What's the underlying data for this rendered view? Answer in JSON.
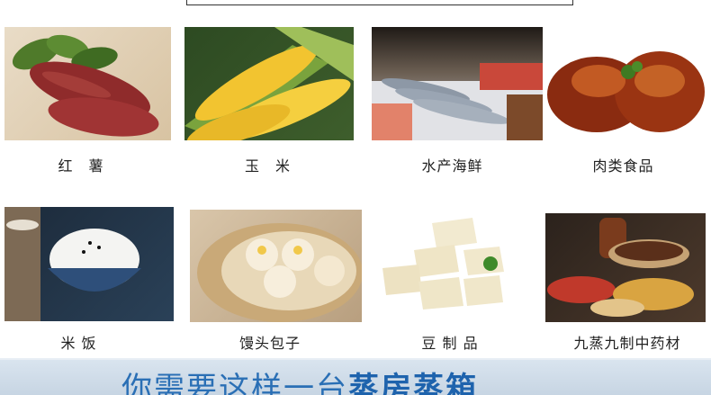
{
  "items": [
    {
      "label": "红　薯"
    },
    {
      "label": "玉　米"
    },
    {
      "label": "水产海鲜"
    },
    {
      "label": "肉类食品"
    },
    {
      "label": "米 饭"
    },
    {
      "label": "馒头包子"
    },
    {
      "label": "豆 制 品"
    },
    {
      "label": "九蒸九制中药材"
    }
  ],
  "banner": {
    "text_prefix": "你需要这样一台",
    "text_strong": "蒸房蒸箱"
  },
  "colors": {
    "banner_text": "#2a6fb5",
    "banner_bg": "#d9e4ef"
  }
}
